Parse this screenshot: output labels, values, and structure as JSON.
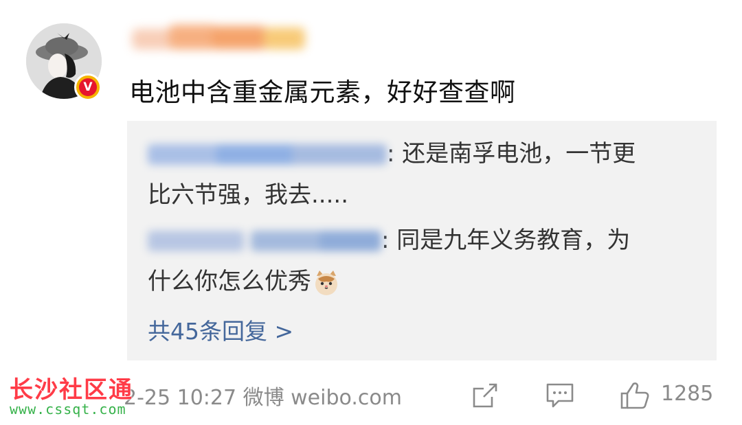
{
  "comment": {
    "text": "电池中含重金属元素，好好查查啊",
    "user_badge": "V"
  },
  "replies": [
    {
      "line1": ": 还是南孚电池，一节更",
      "line2": "比六节强，我去....."
    },
    {
      "line1": ": 同是九年义务教育，为",
      "line2": "什么你怎么优秀"
    }
  ],
  "more_replies": "共45条回复 >",
  "meta": "2-25 10:27 微博 weibo.com",
  "likes": "1285",
  "watermark": {
    "title": "长沙社区通",
    "url": "www.cssqt.com"
  },
  "colors": {
    "link": "#44679b",
    "reply_bg": "#f2f2f2",
    "badge_outer": "#f5b400",
    "badge_inner": "#e6162d",
    "watermark_title": "#ff3b47",
    "watermark_url": "#36b24a"
  },
  "icons": [
    "avatar",
    "verified-badge-icon",
    "cat-emoji-icon",
    "share-icon",
    "comment-icon",
    "like-icon"
  ]
}
